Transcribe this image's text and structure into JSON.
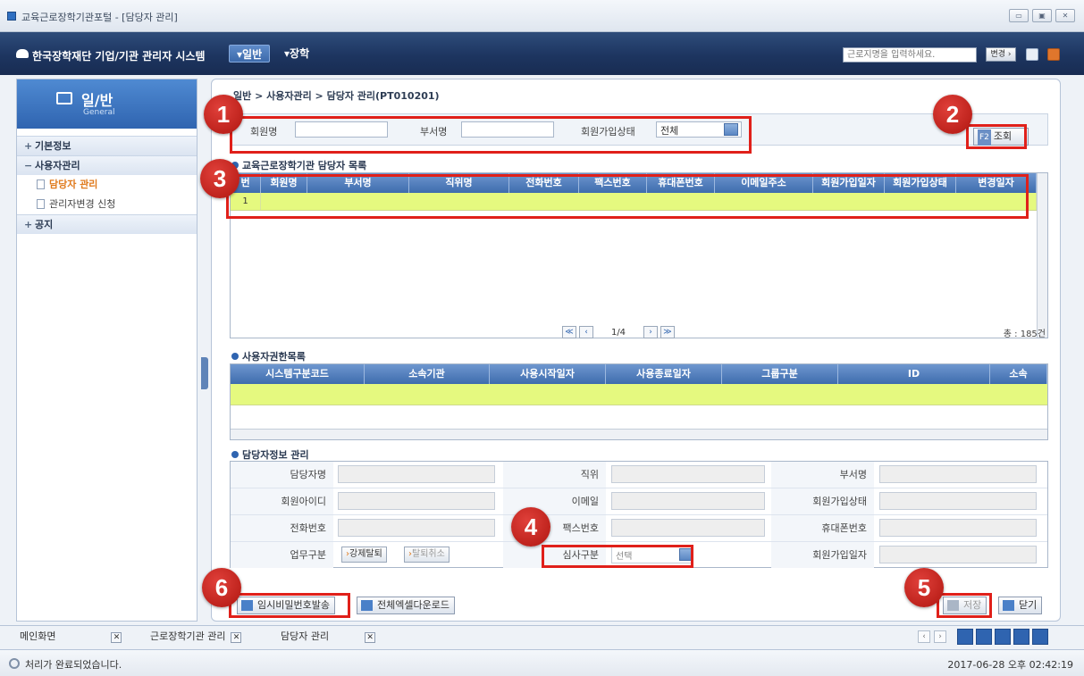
{
  "window": {
    "title": "교육근로장학기관포털 - [담당자 관리]",
    "controls": [
      "▭",
      "▣",
      "✕"
    ]
  },
  "topnav": {
    "logo_text": "한국장학재단 기업/기관 관리자 시스템",
    "menus": [
      {
        "label": "▾일반",
        "active": true
      },
      {
        "label": "▾장학",
        "active": false
      }
    ],
    "search_placeholder": "근로지명을 입력하세요.",
    "change_label": "변경 ›"
  },
  "sidebar": {
    "title": "일/반",
    "subtitle": "General",
    "items": [
      {
        "type": "group",
        "sign": "+",
        "label": "기본정보"
      },
      {
        "type": "group",
        "sign": "−",
        "label": "사용자관리"
      },
      {
        "type": "sub",
        "label": "담당자 관리",
        "active": true
      },
      {
        "type": "sub",
        "label": "관리자변경 신청",
        "active": false
      },
      {
        "type": "group",
        "sign": "+",
        "label": "공지"
      }
    ]
  },
  "breadcrumb": "일반 > 사용자관리 > 담당자 관리(PT010201)",
  "search": {
    "member_name_label": "회원명",
    "member_name_value": "",
    "dept_label": "부서명",
    "dept_value": "",
    "status_label": "회원가입상태",
    "status_value": "전체",
    "button_label": "조회",
    "button_key": "F2"
  },
  "manager_list": {
    "title": "교육근로장학기관 담당자 목록",
    "columns": [
      "번",
      "회원명",
      "부서명",
      "직위명",
      "전화번호",
      "팩스번호",
      "휴대폰번호",
      "이메일주소",
      "회원가입일자",
      "회원가입상태",
      "변경일자"
    ],
    "rows": [
      [
        "1",
        "",
        "",
        "",
        "",
        "",
        "",
        "",
        "",
        "",
        ""
      ]
    ],
    "pager": {
      "first": "≪",
      "prev": "‹",
      "page": "1/4",
      "next": "›",
      "last": "≫"
    },
    "total": "총 : 185건"
  },
  "permission_list": {
    "title": "사용자권한목록",
    "columns": [
      "시스템구분코드",
      "소속기관",
      "사용시작일자",
      "사용종료일자",
      "그룹구분",
      "ID",
      "소속"
    ]
  },
  "info_form": {
    "title": "담당자정보 관리",
    "labels": {
      "manager_name": "담당자명",
      "position": "직위",
      "dept": "부서명",
      "member_id": "회원아이디",
      "email": "이메일",
      "join_status": "회원가입상태",
      "phone": "전화번호",
      "fax": "팩스번호",
      "mobile": "휴대폰번호",
      "work_type": "업무구분",
      "review_type": "심사구분",
      "join_date": "회원가입일자"
    },
    "review_value": "선택",
    "force_withdraw": "강제탈퇴",
    "cancel_withdraw": "탈퇴취소"
  },
  "bottom_buttons": {
    "temp_password": "임시비밀번호발송",
    "excel_download": "전체엑셀다운로드",
    "save": "저장",
    "close": "닫기"
  },
  "task_tabs": [
    {
      "label": "메인화면"
    },
    {
      "label": "근로장학기관 관리"
    },
    {
      "label": "담당자 관리"
    }
  ],
  "status": {
    "message": "처리가 완료되었습니다.",
    "datetime": "2017-06-28 오후 02:42:19"
  },
  "callouts": [
    "1",
    "2",
    "3",
    "4",
    "5",
    "6"
  ],
  "colors": {
    "nav_bg": "#1d3560",
    "grid_header": "#4f7ebf",
    "row_highlight": "#e5f97f",
    "callout_red": "#e0201a",
    "active_menu": "#e07a1c"
  }
}
